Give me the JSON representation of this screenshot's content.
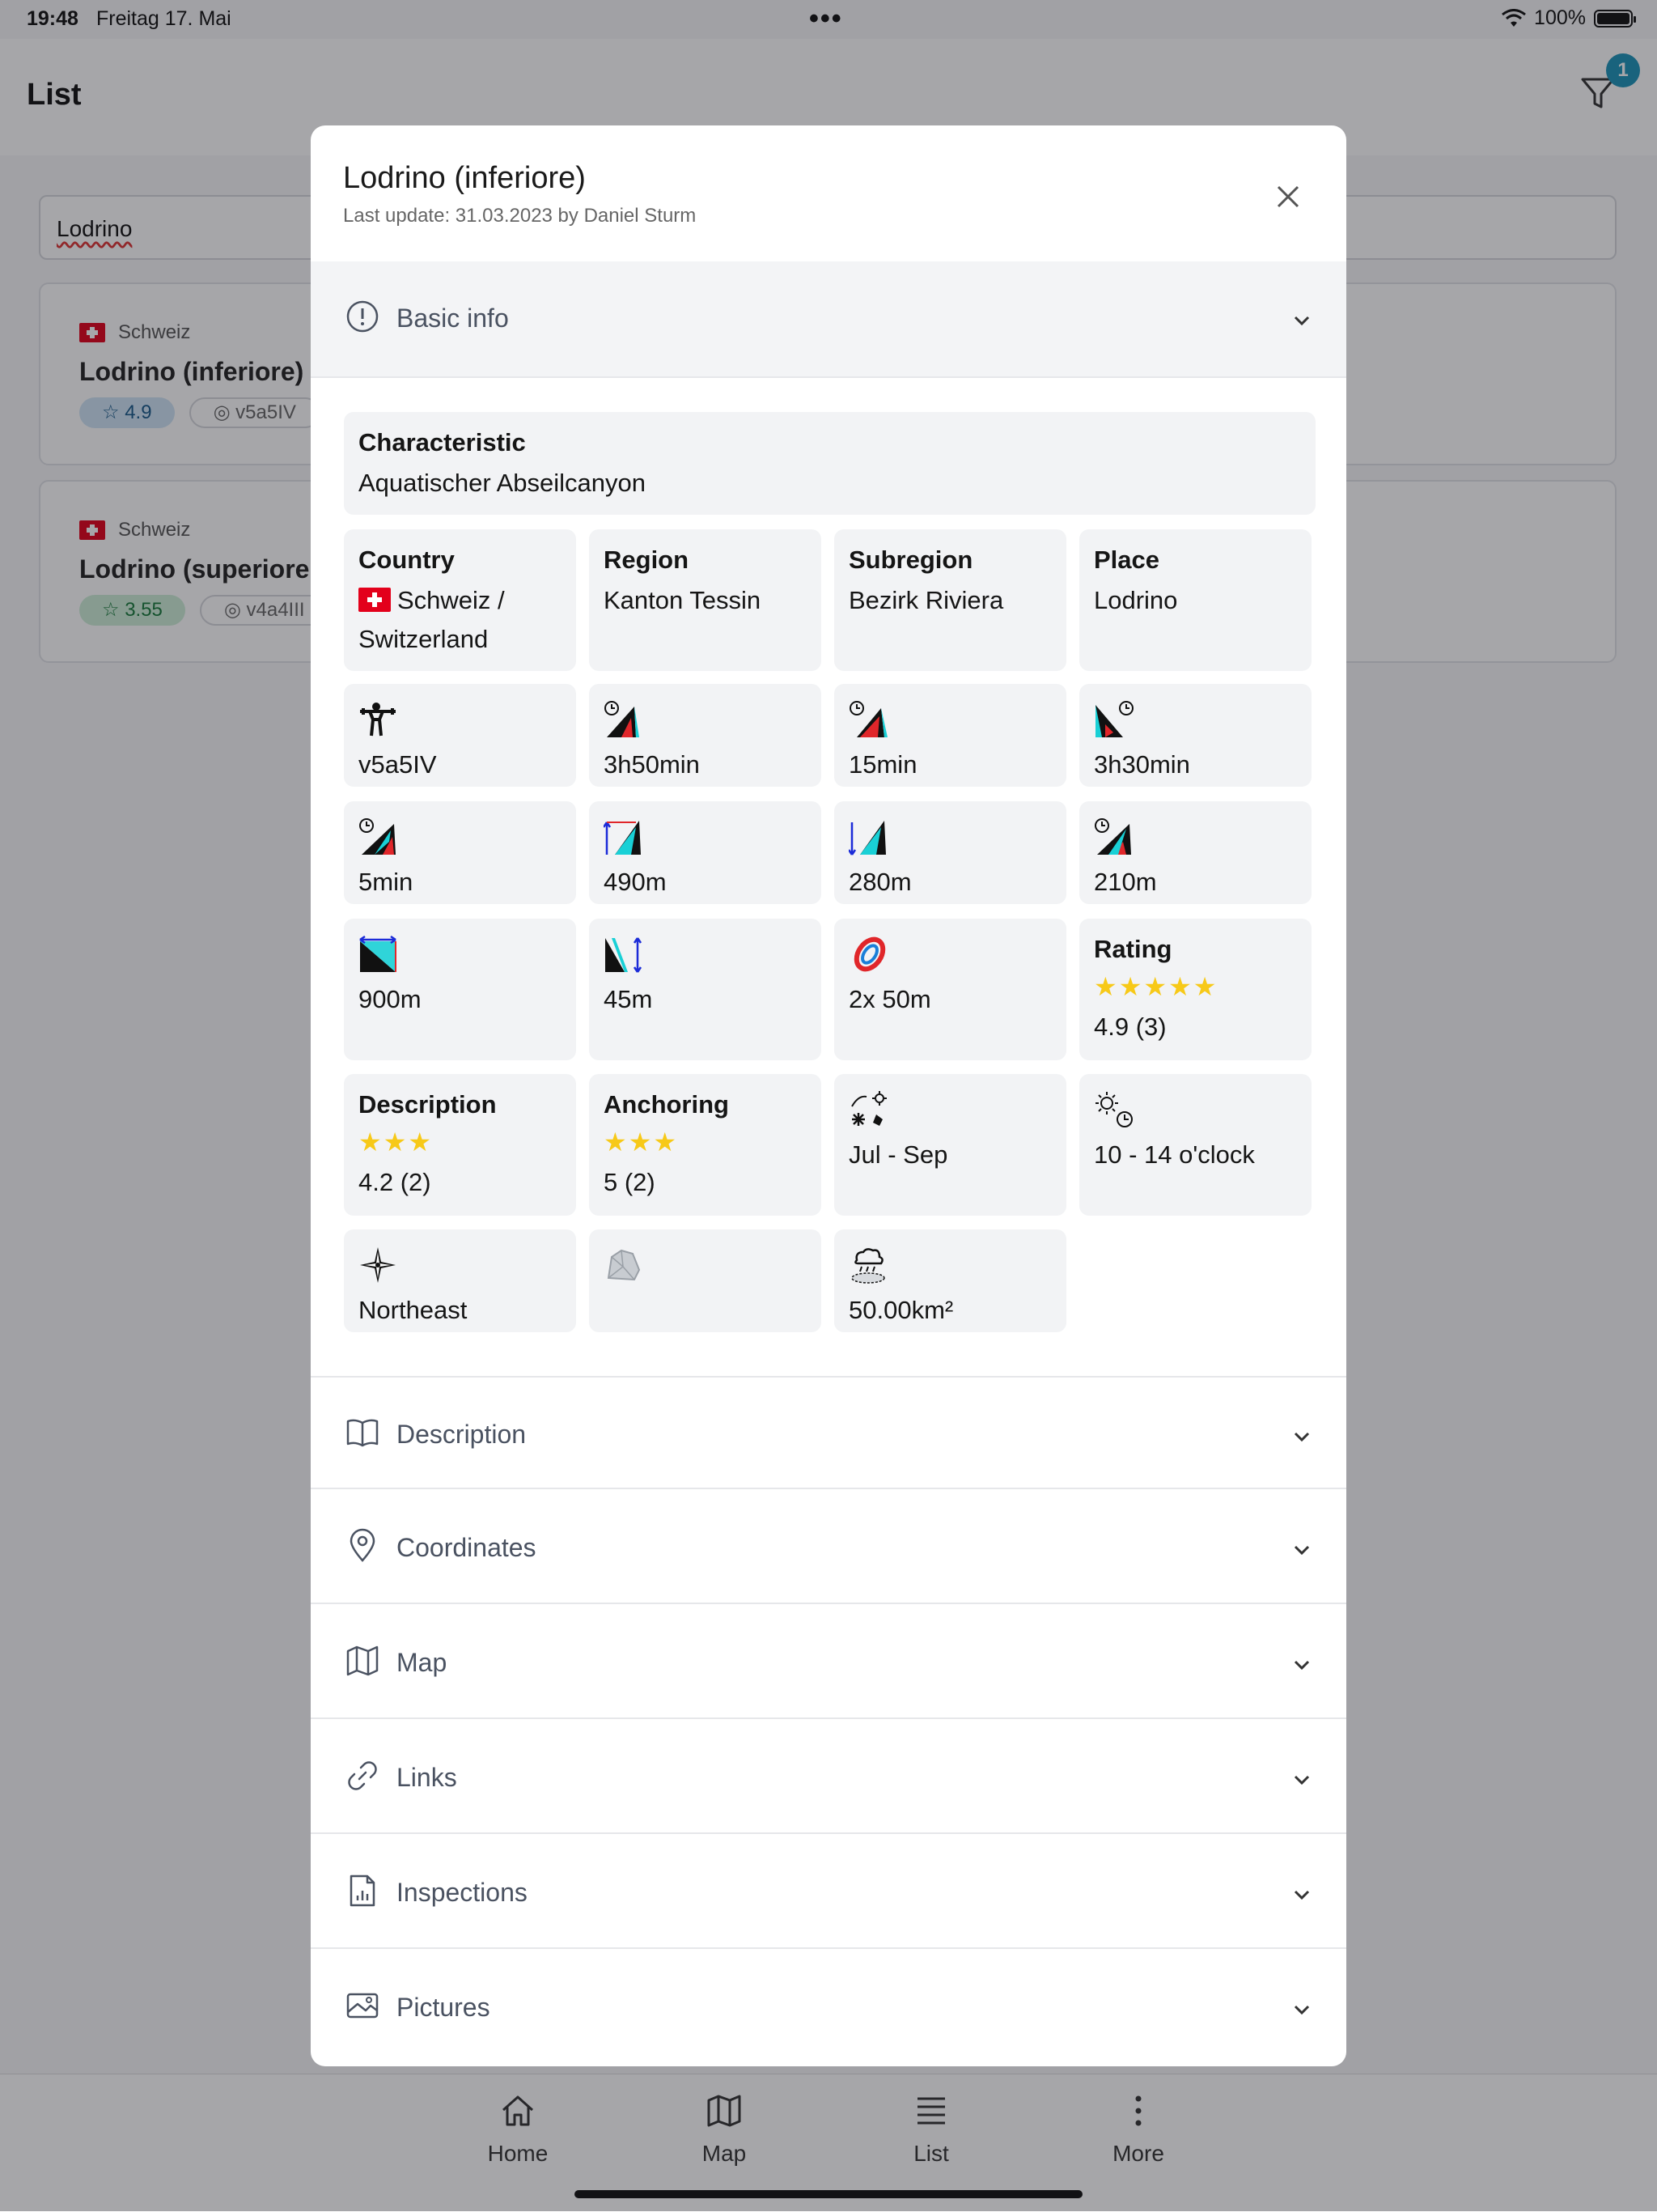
{
  "status_bar": {
    "time": "19:48",
    "date": "Freitag 17. Mai",
    "battery": "100%"
  },
  "app": {
    "title": "List",
    "filter_count": "1",
    "search_value": "Lodrino"
  },
  "list": [
    {
      "country": "Schweiz",
      "name": "Lodrino (inferiore)",
      "rating": "4.9",
      "grade": "v5a5IV"
    },
    {
      "country": "Schweiz",
      "name": "Lodrino (superiore",
      "rating": "3.55",
      "grade": "v4a4III"
    }
  ],
  "modal": {
    "title": "Lodrino (inferiore)",
    "subtitle": "Last update: 31.03.2023 by Daniel Sturm",
    "sections": {
      "basic_info": "Basic info",
      "description": "Description",
      "coordinates": "Coordinates",
      "map": "Map",
      "links": "Links",
      "inspections": "Inspections",
      "pictures": "Pictures"
    },
    "characteristic": {
      "label": "Characteristic",
      "value": "Aquatischer Abseilcanyon"
    },
    "country": {
      "label": "Country",
      "value_line1": "Schweiz /",
      "value_line2": "Switzerland"
    },
    "region": {
      "label": "Region",
      "value": "Kanton Tessin"
    },
    "subregion": {
      "label": "Subregion",
      "value": "Bezirk Riviera"
    },
    "place": {
      "label": "Place",
      "value": "Lodrino"
    },
    "stats": {
      "grade": "v5a5IV",
      "total_time": "3h50min",
      "approach_time": "15min",
      "descent_time": "3h30min",
      "return_time": "5min",
      "ascent": "490m",
      "descent": "280m",
      "height": "210m",
      "length": "900m",
      "max_rappel": "45m",
      "rope": "2x 50m",
      "orientation": "Northeast",
      "catchment": "50.00km²",
      "season": "Jul - Sep",
      "best_time": "10 - 14 o'clock"
    },
    "rating": {
      "label": "Rating",
      "stars": "★★★★★",
      "value": "4.9 (3)"
    },
    "description_rating": {
      "label": "Description",
      "stars": "★★★",
      "value": "4.2 (2)"
    },
    "anchoring_rating": {
      "label": "Anchoring",
      "stars": "★★★",
      "value": "5 (2)"
    }
  },
  "tabs": {
    "home": "Home",
    "map": "Map",
    "list": "List",
    "more": "More"
  },
  "colors": {
    "accent": "#1c93b8",
    "star": "#f7c918",
    "card_bg": "#f2f3f5"
  }
}
